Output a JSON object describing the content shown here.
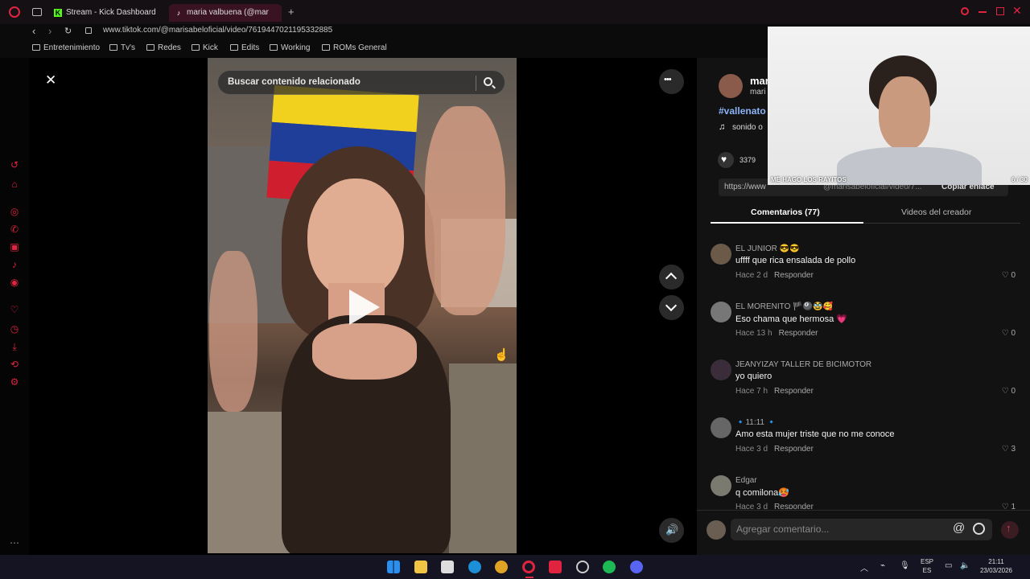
{
  "browser": {
    "tabs": [
      {
        "title": "Stream - Kick Dashboard",
        "icon": "kick-icon"
      },
      {
        "title": "maria valbuena (@mar",
        "icon": "tiktok-icon"
      }
    ],
    "new_tab_label": "+",
    "url": "www.tiktok.com/@marisabeloficial/video/7619447021195332885",
    "bookmarks": [
      "Entretenimiento",
      "Tv's",
      "Redes",
      "Kick",
      "Edits",
      "Working",
      "ROMs General"
    ]
  },
  "player": {
    "search_placeholder": "Buscar contenido relacionado",
    "close_glyph": "✕",
    "more_glyph": "•••"
  },
  "post": {
    "author_display": "mar",
    "author_sub": "mari",
    "hashtag": "#vallenato",
    "sound": "sonido o",
    "likes": "3379",
    "link": "https://www",
    "link_tail": "@marisabeloficial/video/7...",
    "copy_link": "Copiar enlace"
  },
  "tabs": {
    "comments": "Comentarios (77)",
    "creator_videos": "Videos del creador"
  },
  "comments": [
    {
      "user": "EL JUNIOR 😎😎",
      "text": "uffff que rica ensalada de pollo",
      "time": "Hace 2 d",
      "reply": "Responder",
      "likes": "0"
    },
    {
      "user": "EL MORENITO 🏴🎱🥸🥰",
      "text": "Eso chama que hermosa 💗",
      "time": "Hace 13 h",
      "reply": "Responder",
      "likes": "0"
    },
    {
      "user": "JEANYIZAY TALLER DE BICIMOTOR",
      "text": "yo quiero",
      "time": "Hace 7 h",
      "reply": "Responder",
      "likes": "0"
    },
    {
      "user": "🔹11:11 🔹",
      "text": "Amo esta mujer triste que no me conoce",
      "time": "Hace 3 d",
      "reply": "Responder",
      "likes": "3"
    },
    {
      "user": "Edgar",
      "text": "q comilona🥵",
      "time": "Hace 3 d",
      "reply": "Responder",
      "likes": "1"
    }
  ],
  "comment_input_placeholder": "Agregar comentario...",
  "webcam": {
    "caption": "ME HAGO LOS RAYITOS",
    "counter": "6 / 30"
  },
  "tray": {
    "lang_top": "ESP",
    "lang_bottom": "ES",
    "time": "21:11",
    "date": "23/03/2026"
  },
  "colors": {
    "accent_red": "#e0243f",
    "link_blue": "#8ab4f8"
  }
}
